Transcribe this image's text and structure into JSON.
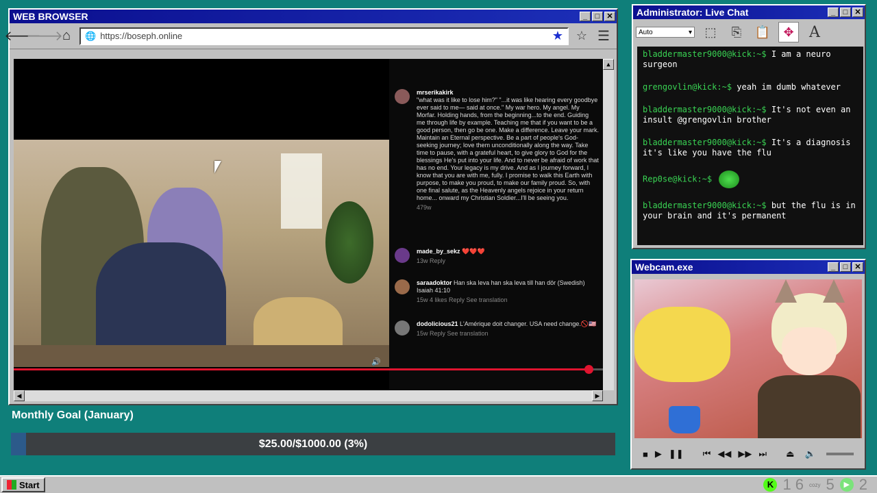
{
  "browser": {
    "title": "WEB BROWSER",
    "url": "https://boseph.online",
    "controls": {
      "minimize": "_",
      "maximize": "□",
      "close": "✕"
    }
  },
  "comments": [
    {
      "user": "mrserikakirk",
      "text": "\"what was it like to lose him?\" \"...it was like hearing every goodbye ever said to me— said at once.\" My war hero. My angel. My Morfar. Holding hands, from the beginning...to the end. Guiding me through life by example. Teaching me that if you want to be a good person, then go be one. Make a difference. Leave your mark. Maintain an Eternal perspective. Be a part of people's God-seeking journey; love them unconditionally along the way. Take time to pause, with a grateful heart, to give glory to God for the blessings He's put into your life. And to never be afraid of work that has no end. Your legacy is my drive. And as I journey forward, I know that you are with me, fully. I promise to walk this Earth with purpose, to make you proud, to make our family proud. So, with one final salute, as the Heavenly angels rejoice in your return home... onward my Christian Soldier...I'll be seeing you.",
      "meta": "479w"
    },
    {
      "user": "made_by_sekz",
      "text": "❤️❤️❤️",
      "meta": "13w  Reply"
    },
    {
      "user": "saraadoktor",
      "text": "Han ska leva han ska leva till han dör (Swedish) Isaiah 41:10",
      "meta": "15w  4 likes  Reply  See translation"
    },
    {
      "user": "dodolicious21",
      "text": "L'Amérique doit changer. USA need change.🚫🇺🇸",
      "meta": "15w  Reply  See translation"
    }
  ],
  "video": {
    "progress_fraction": 0.975
  },
  "goal": {
    "title": "Monthly Goal (January)",
    "text": "$25.00/$1000.00 (3%)",
    "fraction": 0.025,
    "fill_color": "#2c5a8a"
  },
  "chat": {
    "title": "Administrator: Live Chat",
    "select_value": "Auto",
    "messages": [
      {
        "user": "bladdermaster9000@kick:~$",
        "text": " I am a neuro surgeon"
      },
      {
        "user": "grengovlin@kick:~$",
        "text": " yeah im dumb whatever"
      },
      {
        "user": "bladdermaster9000@kick:~$",
        "text": " It's not even an insult @grengovlin brother"
      },
      {
        "user": "bladdermaster9000@kick:~$",
        "text": " It's a diagnosis it's like you have the flu"
      },
      {
        "user": "Rep0se@kick:~$",
        "text": ""
      },
      {
        "user": "bladdermaster9000@kick:~$",
        "text": " but the flu is in your brain and it's permanent"
      }
    ],
    "prompt_color": "#39d353"
  },
  "webcam": {
    "title": "Webcam.exe"
  },
  "taskbar": {
    "start_label": "Start",
    "count_a": "1 6",
    "cozy_label": "cozy",
    "count_b": "5",
    "count_c": "2"
  }
}
